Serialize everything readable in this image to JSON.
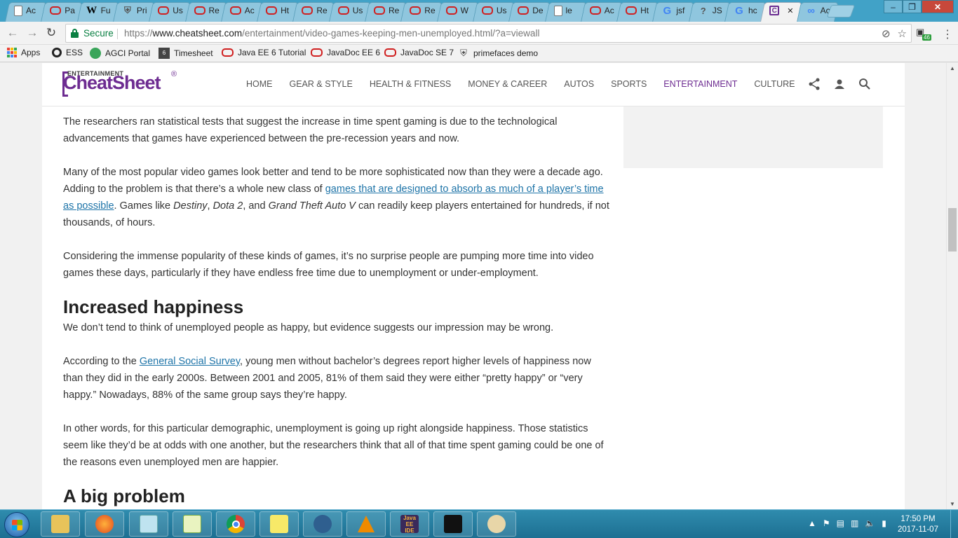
{
  "tabs": [
    {
      "label": "Ac",
      "favicon": "page-icon"
    },
    {
      "label": "Pa",
      "favicon": "oracle-icon"
    },
    {
      "label": "Fu",
      "favicon": "wikipedia-icon"
    },
    {
      "label": "Pri",
      "favicon": "shield-icon"
    },
    {
      "label": "Us",
      "favicon": "oracle-icon"
    },
    {
      "label": "Re",
      "favicon": "oracle-icon"
    },
    {
      "label": "Ac",
      "favicon": "oracle-icon"
    },
    {
      "label": "Ht",
      "favicon": "oracle-icon"
    },
    {
      "label": "Re",
      "favicon": "oracle-icon"
    },
    {
      "label": "Us",
      "favicon": "oracle-icon"
    },
    {
      "label": "Re",
      "favicon": "oracle-icon"
    },
    {
      "label": "Re",
      "favicon": "oracle-icon"
    },
    {
      "label": "W",
      "favicon": "oracle-icon"
    },
    {
      "label": "Us",
      "favicon": "oracle-icon"
    },
    {
      "label": "De",
      "favicon": "oracle-icon"
    },
    {
      "label": "le",
      "favicon": "page-icon"
    },
    {
      "label": "Ac",
      "favicon": "oracle-icon"
    },
    {
      "label": "Ht",
      "favicon": "oracle-icon"
    },
    {
      "label": "jsf",
      "favicon": "google-icon"
    },
    {
      "label": "JS",
      "favicon": "question-icon"
    },
    {
      "label": "hc",
      "favicon": "google-icon"
    },
    {
      "label": "",
      "favicon": "cheatsheet-icon",
      "active": true
    },
    {
      "label": "Ac",
      "favicon": "people-icon"
    }
  ],
  "address_bar": {
    "secure_label": "Secure",
    "url_scheme": "https://",
    "url_host": "www.cheatsheet.com",
    "url_path": "/entertainment/video-games-keeping-men-unemployed.html/?a=viewall",
    "extension_badge": "46"
  },
  "bookmarks": [
    {
      "label": "Apps",
      "icon": "apps-icon"
    },
    {
      "label": "ESS",
      "icon": "ess-icon"
    },
    {
      "label": "AGCI Portal",
      "icon": "agci-icon"
    },
    {
      "label": "Timesheet",
      "icon": "timesheet-icon"
    },
    {
      "label": "Java EE 6 Tutorial",
      "icon": "oracle-icon"
    },
    {
      "label": "JavaDoc EE 6",
      "icon": "oracle-icon"
    },
    {
      "label": "JavaDoc SE 7",
      "icon": "oracle-icon"
    },
    {
      "label": "primefaces demo",
      "icon": "primefaces-icon"
    }
  ],
  "site": {
    "logo_small": "ENTERTAINMENT",
    "logo_main": "CheatSheet",
    "logo_reg": "®",
    "nav": [
      "HOME",
      "GEAR & STYLE",
      "HEALTH & FITNESS",
      "MONEY & CAREER",
      "AUTOS",
      "SPORTS",
      "ENTERTAINMENT",
      "CULTURE"
    ],
    "active_nav": "ENTERTAINMENT",
    "brand_color": "#6d2c91",
    "link_color": "#1e74a8"
  },
  "article": {
    "p1": "The researchers ran statistical tests that suggest the increase in time spent gaming is due to the technological advancements that games have experienced between the pre-recession years and now.",
    "p2_a": "Many of the most popular video games look better and tend to be more sophisticated now than they were a decade ago. Adding to the problem is that there’s a whole new class of ",
    "p2_link": "games that are designed to absorb as much of a player’s time as possible",
    "p2_b": ". Games like ",
    "p2_g1": "Destiny",
    "p2_c": ", ",
    "p2_g2": "Dota 2",
    "p2_d": ", and ",
    "p2_g3": "Grand Theft Auto V",
    "p2_e": " can readily keep players entertained for hundreds, if not thousands, of hours.",
    "p3": "Considering the immense popularity of these kinds of games, it’s no surprise people are pumping more time into video games these days, particularly if they have endless free time due to unemployment or under-employment.",
    "h1": "Increased happiness",
    "p4": "We don’t tend to think of unemployed people as happy, but evidence suggests our impression may be wrong.",
    "p5_a": "According to the ",
    "p5_link": "General Social Survey",
    "p5_b": ", young men without bachelor’s degrees report higher levels of happiness now than they did in the early 2000s. Between 2001 and 2005, 81% of them said they were either “pretty happy” or “very happy.” Nowadays, 88% of the same group says they’re happy.",
    "p6": "In other words, for this particular demographic, unemployment is going up right alongside happiness. Those statistics seem like they’d be at odds with one another, but the researchers think that all of that time spent gaming could be one of the reasons even unemployed men are happier.",
    "h2": "A big problem"
  },
  "taskbar": {
    "apps": [
      "file-explorer-icon",
      "firefox-icon",
      "notepad-icon",
      "notepad-plus-icon",
      "chrome-icon",
      "sticky-notes-icon",
      "postgres-icon",
      "vlc-icon",
      "java-ee-ide-icon",
      "inkscape-icon",
      "paint-icon"
    ],
    "java_label": "Java EE IDE",
    "time": "17:50 PM",
    "date": "2017-11-07"
  }
}
